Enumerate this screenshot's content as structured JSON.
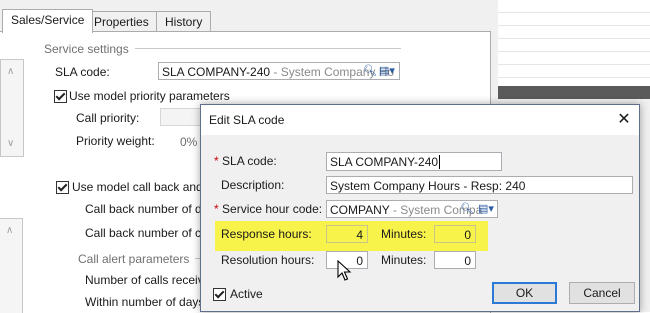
{
  "tabs": [
    {
      "label": "Sales/Service",
      "active": true
    },
    {
      "label": "Properties",
      "active": false
    },
    {
      "label": "History",
      "active": false
    }
  ],
  "service_settings": {
    "group_label": "Service settings",
    "sla_code_label": "SLA code:",
    "sla_code_value": "SLA COMPANY-240",
    "sla_code_desc": " - System Company Ho",
    "use_model_priority_label": "Use model priority parameters",
    "call_priority_label": "Call priority:",
    "priority_weight_label": "Priority weight:",
    "priority_weight_value": "0%",
    "use_model_callback_label": "Use model call back and ca",
    "call_back_days_label": "Call back number of day",
    "call_back_clicks_label": "Call back number of click"
  },
  "call_alert": {
    "group_label": "Call alert parameters",
    "calls_received_label": "Number of calls received",
    "within_days_label": "Within number of days:"
  },
  "dialog": {
    "title": "Edit SLA code",
    "close_glyph": "✕",
    "sla_code_label": "SLA code:",
    "sla_code_value": "SLA COMPANY-240",
    "description_label": "Description:",
    "description_value": "System Company Hours - Resp: 240",
    "service_hour_label": "Service hour code:",
    "service_hour_value": "COMPANY",
    "service_hour_desc": " - System Compa",
    "response_hours_label": "Response hours:",
    "response_hours_value": "4",
    "response_minutes_label": "Minutes:",
    "response_minutes_value": "0",
    "resolution_hours_label": "Resolution hours:",
    "resolution_hours_value": "0",
    "resolution_minutes_label": "Minutes:",
    "resolution_minutes_value": "0",
    "active_label": "Active",
    "ok_label": "OK",
    "cancel_label": "Cancel"
  },
  "colors": {
    "highlight": "#f7f34a",
    "required_marker": "#d10000",
    "default_button_border": "#2b7bd6"
  },
  "icons": [
    "search-icon",
    "picker-icon",
    "close-icon",
    "checkbox-check-icon",
    "mouse-cursor-icon"
  ]
}
